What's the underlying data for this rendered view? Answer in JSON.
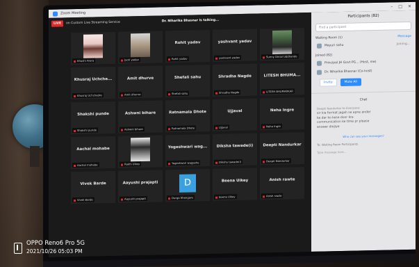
{
  "window": {
    "title": "Zoom Meeting"
  },
  "top": {
    "live_label": "LIVE",
    "service": "on Custom Live Streaming Service",
    "talking": "Dr. Niharika Bhasnar is talking..."
  },
  "tiles": [
    {
      "name": "",
      "cap": "Khushi Arora",
      "photo": "ph1"
    },
    {
      "name": "",
      "cap": "Jyoti yadav",
      "photo": "ph2"
    },
    {
      "name": "Rohit yadav",
      "cap": "Rohit yadav"
    },
    {
      "name": "yashvant yadav",
      "cap": "yashvant yadav"
    },
    {
      "name": "",
      "cap": "Sunny Dinial Uddhande",
      "photo": "ph3"
    },
    {
      "name": "Khusraj Uchche...",
      "cap": "Khusraj Uchchedre"
    },
    {
      "name": "Amit dhurve",
      "cap": "Amit dhurve"
    },
    {
      "name": "Shefali sahu",
      "cap": "Shefali sahu"
    },
    {
      "name": "Shradha Nagde",
      "cap": "Shradha Nagde"
    },
    {
      "name": "LITESH BHUMA...",
      "cap": "LITESH BHUMARKAR"
    },
    {
      "name": "Shakshi punde",
      "cap": "Shakshi punde"
    },
    {
      "name": "Ashwni bihare",
      "cap": "Ashwni bihare"
    },
    {
      "name": "Ratnamala Dhote",
      "cap": "Ratnamala Dhote"
    },
    {
      "name": "Ujjaval",
      "cap": "Ujjaval"
    },
    {
      "name": "Neha Ingre",
      "cap": "Neha Ingre"
    },
    {
      "name": "Aachal mohabe",
      "cap": "Aachal mohabe"
    },
    {
      "name": "",
      "cap": "Rakhi Uikey",
      "photo": "ph4"
    },
    {
      "name": "Yogeshwari wag...",
      "cap": "Yogeshwari wagashe"
    },
    {
      "name": "Diksha tawade(i)",
      "cap": "Diksha tawade(i)"
    },
    {
      "name": "Deepti Nandurkar",
      "cap": "Deepti Nandurkar"
    },
    {
      "name": "Vivek Barde",
      "cap": "Vivek Barde"
    },
    {
      "name": "Aayushi prajapti",
      "cap": "Aayushi prajapti"
    },
    {
      "name": "",
      "cap": "Durga Shengare",
      "letter": "D"
    },
    {
      "name": "Beena Uikey",
      "cap": "beena Uikey"
    },
    {
      "name": "Anish rawte",
      "cap": "Anish rawte"
    }
  ],
  "panel": {
    "title": "Participants (82)",
    "search_placeholder": "Find a participant",
    "waiting": "Waiting Room (1)",
    "message": "Message",
    "waiting_person": "Mayuri sahu",
    "waiting_status": "Joining...",
    "joined": "Joined (82)",
    "joined_people": [
      {
        "name": "Principal JH Govt PG... (Host, me)"
      },
      {
        "name": "Dr. Niharika Bhasnar (Co-host)"
      }
    ],
    "invite": "Invite",
    "mute_all": "Mute All",
    "chat_title": "Chat",
    "chat_from": "Deepti Nandurkar to Everyone:",
    "chat_msg": "sir kia format jagah se apne ander ke dar ko kese door kre communication ke time pr please answer diojiye",
    "who_see": "Who can see your messages?",
    "to": "To: Waiting Room Participants",
    "type": "Type message here..."
  },
  "watermark": {
    "line1": "OPPO Reno6 Pro 5G",
    "line2": "2021/10/26 05:03 PM"
  }
}
